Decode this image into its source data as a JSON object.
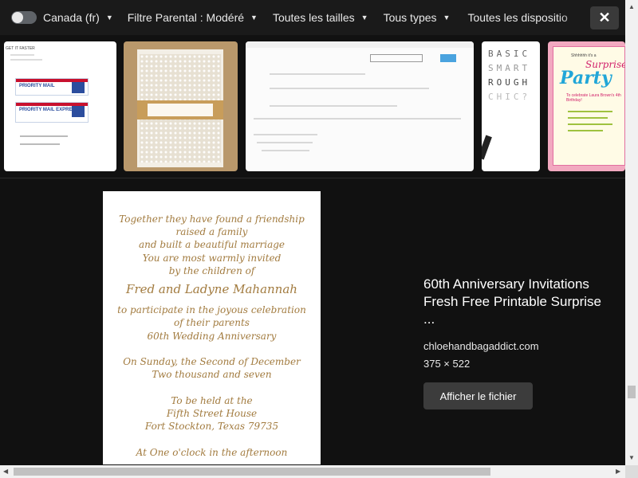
{
  "filter_bar": {
    "region": "Canada (fr)",
    "filters": [
      "Filtre Parental : Modéré",
      "Toutes les tailles",
      "Tous types",
      "Toutes les dispositio"
    ],
    "close_icon": "close-icon",
    "caret_icon": "chevron-down-icon"
  },
  "thumbnails": [
    {
      "name": "shipping-labels",
      "header": "GET IT FASTER",
      "labels": [
        "PRIORITY MAIL",
        "PRIORITY MAIL EXPRESS"
      ]
    },
    {
      "name": "lace-wedding-invitation"
    },
    {
      "name": "code-screenshot"
    },
    {
      "name": "typography-poster",
      "words": [
        "BASIC",
        "SMART",
        "ROUGH",
        "CHIC?"
      ]
    },
    {
      "name": "surprise-party-invitation",
      "line1": "Shhhhhh it's a",
      "line2": "Surprise",
      "line3": "Party",
      "line4": "To celebrate Laura Brown's 4th Birthday!"
    }
  ],
  "preview": {
    "lines": [
      "Together they have found a friendship",
      "raised a family",
      "and built a beautiful marriage",
      "You are most warmly invited",
      "by the children of",
      "Fred and Ladyne Mahannah",
      "to participate in the joyous celebration",
      "of their parents",
      "60th Wedding Anniversary",
      "On Sunday, the Second of December",
      "Two thousand and seven",
      "To be held at the",
      "Fifth Street House",
      "Fort Stockton, Texas 79735",
      "At One o'clock in the afternoon"
    ]
  },
  "info": {
    "title": "60th Anniversary Invitations Fresh Free Printable Surprise ...",
    "source": "chloehandbagaddict.com",
    "dimensions": "375 × 522",
    "view_button": "Afficher le fichier"
  },
  "colors": {
    "background": "#111111",
    "bar": "#1a1a1a",
    "invitation_text": "#a27b3f",
    "button": "#3c3c3c"
  }
}
